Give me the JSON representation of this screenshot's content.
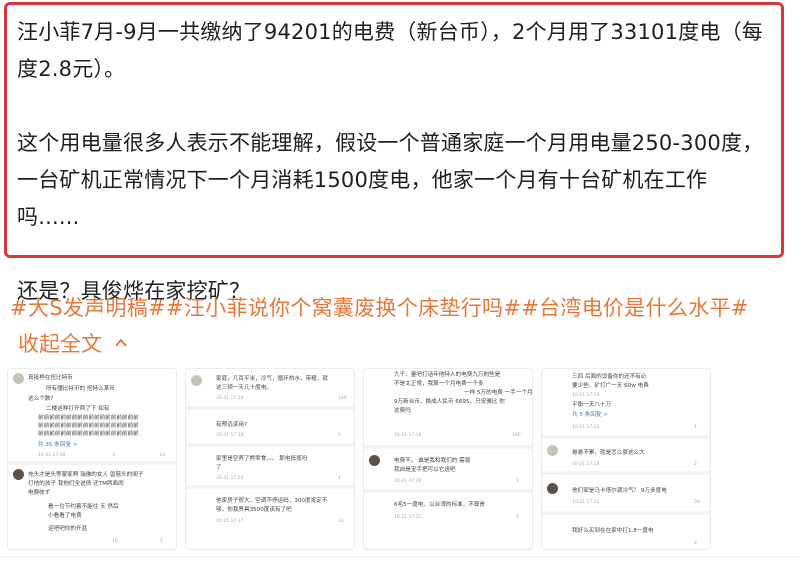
{
  "post": {
    "para1": "汪小菲7月-9月一共缴纳了94201的电费（新台币），2个月用了33101度电（每度2.8元）。",
    "para2": "这个用电量很多人表示不能理解，假设一个普通家庭一个月用电量250-300度，一台矿机正常情况下一个月消耗1500度电，他家一个月有十台矿机在工作吗......",
    "para3": "还是？具俊烨在家挖矿？"
  },
  "hashtags": {
    "text": "#大S发声明稿##汪小菲说你个窝囊废换个床垫行吗##台湾电价是什么水平#"
  },
  "collapse": {
    "label": "收起全文",
    "icon": "chevron-up-icon"
  },
  "colors": {
    "accent": "#e8783a",
    "highlight_border": "#d9383a"
  },
  "screenshots": [
    {
      "lines": [
        "真挺桦在挖比特币",
        "所有懂比特币的 挖特么某币",
        "这么个数?",
        "二楼这种打开两了下 如有",
        "前前前前前前前前前前前前前前前前前前",
        "前前前前前前前前前前前前前前前前前前",
        "前前前前前前前前前前前前前前前前前前",
        "共 35 条回复 >",
        "10-21 17:18",
        "充头才是头等蒙家啊 瑞佛的女人 兽慈头的闺子 ",
        "打他的孩子 我他们全说债 还TM两面闹 ",
        "电费帐ず",
        "看一位节约着不能往 天 然后",
        "小看看了电费",
        "迎吧吧你的开盆"
      ],
      "counts": [
        "3",
        "81",
        "16",
        "1"
      ]
    },
    {
      "lines": [
        "家庭，几百平米，冷气，循环热水，带粗，就",
        "这三顿一天几十度电。",
        "10-21 17:18",
        "有预远读用?",
        "10-21 17:18",
        "家里是空养了熊零食。。。 那电抵揽吗",
        "了",
        "10-21 17:22",
        "他家房子很大，空调不停运码，300度肯定不",
        "够，你我界具3500度该有了吧",
        "10-21 17:17"
      ],
      "counts": [
        "180",
        "5",
        "1",
        "33"
      ]
    },
    {
      "lines": [
        "九千、量吧打话年他特人的电费九万刷些是",
        "不是太正常，我算一个月电费一千多",
        "一样 5万的电费 一手一个月",
        "9万新台币，换成人民币 6695，只安雅比 你",
        "这费吗",
        "10-21 17:18",
        "电费不。 谁是我和我们的 需源",
        "我自是宝手把可以它送吧",
        "10-21 17:20",
        "6毛5一度电，以台湾的标准，不算贵",
        "10-21 17:21"
      ],
      "counts": [
        "180",
        "1",
        "2"
      ]
    },
    {
      "lines": [
        "三四 后面的设备你的还不有必",
        "要少些。矿打广一天 60w 电费",
        "10-21 17:19",
        "平衡一天八十万",
        "共 5 条回复 >",
        "10-21 17:21",
        "悬悬不累，就是怎么豪这么大",
        "10-21 17:18",
        "他们家是马卡塔尔调冷气？ 9万多度电",
        "10-21 17:22",
        "我好么买到在在家中打1.8一度电"
      ],
      "counts": [
        "1",
        "2",
        "38",
        "8"
      ]
    }
  ]
}
